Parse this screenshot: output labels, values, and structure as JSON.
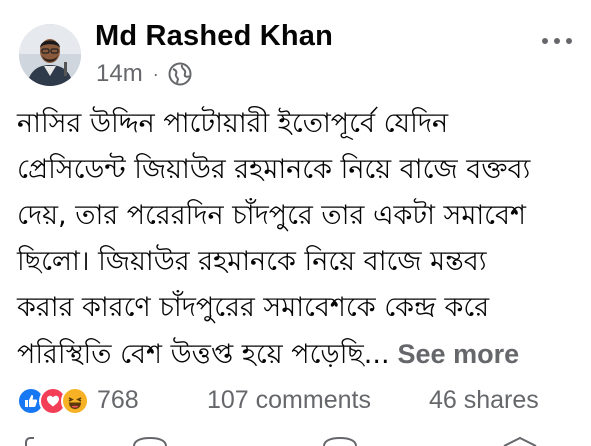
{
  "post": {
    "author": {
      "name": "Md Rashed Khan",
      "time": "14m",
      "separator": "·",
      "privacy_icon": "globe-icon"
    },
    "more_icon": "more-options-icon",
    "body_lines": [
      "নাসির উদ্দিন পাটোয়ারী ইতোপূর্বে যেদিন",
      "প্রেসিডেন্ট জিয়াউর রহমানকে নিয়ে বাজে বক্তব্য",
      "দেয়, তার পরেরদিন চাঁদপুরে তার একটা সমাবেশ",
      "ছিলো। জিয়াউর রহমানকে নিয়ে বাজে মন্তব্য",
      "করার কারণে চাঁদপুরের সমাবেশকে কেন্দ্র করে",
      "পরিস্থিতি বেশ উত্তপ্ত হয়ে পড়েছি..."
    ],
    "see_more": "See more",
    "stats": {
      "reaction_icons": [
        "like-icon",
        "love-icon",
        "haha-icon"
      ],
      "reaction_count": "768",
      "comments": "107 comments",
      "shares": "46 shares"
    }
  },
  "colors": {
    "like": "#1877f2",
    "love": "#f33e58",
    "haha": "#f7b125",
    "muted_text": "#65676b",
    "text": "#050505"
  }
}
